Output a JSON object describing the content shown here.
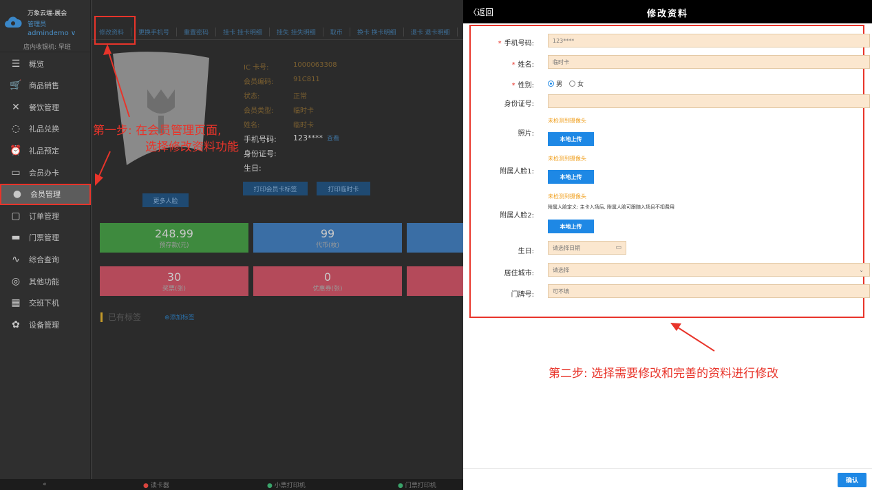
{
  "sidebar": {
    "brand_name": "万象云端-展会",
    "role": "管理员",
    "user": "admindemo ∨",
    "cashier": "店内收银机: 早班",
    "items": [
      {
        "label": "概览",
        "icon": "menu-icon"
      },
      {
        "label": "商品销售",
        "icon": "cart-icon"
      },
      {
        "label": "餐饮管理",
        "icon": "utensils-icon"
      },
      {
        "label": "礼品兑换",
        "icon": "gift-icon"
      },
      {
        "label": "礼品预定",
        "icon": "alarm-icon"
      },
      {
        "label": "会员办卡",
        "icon": "card-icon"
      },
      {
        "label": "会员管理",
        "icon": "user-icon"
      },
      {
        "label": "订单管理",
        "icon": "clipboard-icon"
      },
      {
        "label": "门票管理",
        "icon": "printer-icon"
      },
      {
        "label": "综合查询",
        "icon": "pulse-icon"
      },
      {
        "label": "其他功能",
        "icon": "aperture-icon"
      },
      {
        "label": "交班下机",
        "icon": "calculator-icon"
      },
      {
        "label": "设备管理",
        "icon": "gear-icon"
      }
    ],
    "collapse": "«"
  },
  "statusbar": {
    "reader": "读卡器",
    "small_printer": "小票打印机",
    "ticket_printer": "门票打印机"
  },
  "member_tabs": [
    "修改资料",
    "更换手机号",
    "重置密码",
    "挂卡 挂卡明细",
    "挂失 挂失明细",
    "取币",
    "换卡 换卡明细",
    "退卡 退卡明细"
  ],
  "member_info": [
    {
      "k": "IC 卡号:",
      "v": "1000063308"
    },
    {
      "k": "会员编码:",
      "v": "91C811"
    },
    {
      "k": "状态:",
      "v": "正常"
    },
    {
      "k": "会员类型:",
      "v": "临时卡"
    },
    {
      "k": "姓名:",
      "v": "临时卡"
    }
  ],
  "member_info_plain": [
    {
      "k": "手机号码:",
      "v": "123****",
      "link": "查看"
    },
    {
      "k": "身份证号:",
      "v": ""
    },
    {
      "k": "生日:",
      "v": ""
    }
  ],
  "member_buttons": {
    "print_label": "打印会员卡标签",
    "print_temp": "打印临时卡",
    "more_faces": "更多人脸"
  },
  "stats": [
    {
      "n": "248.99",
      "l": "预存款(元)",
      "color": "#3e8a3e"
    },
    {
      "n": "99",
      "l": "代币(枚)",
      "color": "#3a6ea5"
    },
    {
      "n": "",
      "l": "",
      "color": "#3a6ea5"
    },
    {
      "n": "30",
      "l": "奖票(张)",
      "color": "#b44a5a"
    },
    {
      "n": "0",
      "l": "优惠券(张)",
      "color": "#b44a5a"
    },
    {
      "n": "",
      "l": "",
      "color": "#b44a5a"
    }
  ],
  "tags": {
    "title": "已有标签",
    "add": "添加标签"
  },
  "annotations": {
    "step1_line1": "第一步: 在会员管理页面,",
    "step1_line2": "选择修改资料功能",
    "step2": "第二步: 选择需要修改和完善的资料进行修改"
  },
  "phone": {
    "back": "〈返回",
    "title": "修改资料",
    "confirm": "确认",
    "form": {
      "phone_label": "手机号码:",
      "phone_value": "123****",
      "name_label": "姓名:",
      "name_value": "临时卡",
      "gender_label": "性别:",
      "gender_male": "男",
      "gender_female": "女",
      "idcard_label": "身份证号:",
      "idcard_value": "",
      "photo_label": "照片:",
      "face1_label": "附属人脸1:",
      "face2_label": "附属人脸2:",
      "camera_warn": "未检测到摄像头",
      "upload": "本地上传",
      "face_hint": "附属人脸定义: 主卡入场后, 附属人脸可跟随入场且不扣费用",
      "birthday_label": "生日:",
      "birthday_placeholder": "请选择日期",
      "city_label": "居住城市:",
      "city_placeholder": "请选择",
      "door_label": "门牌号:",
      "door_placeholder": "可不填"
    }
  }
}
